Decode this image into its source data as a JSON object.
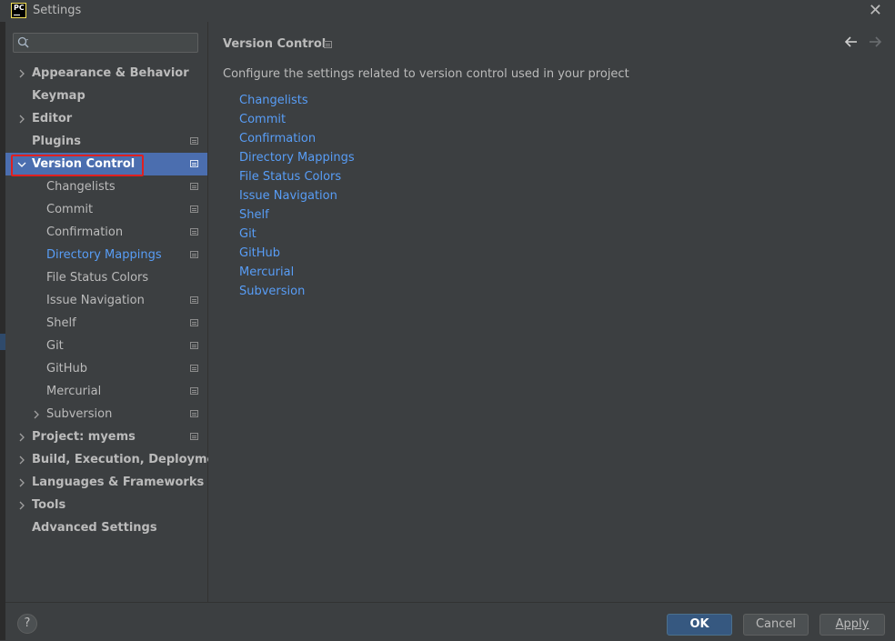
{
  "window": {
    "title": "Settings",
    "app_logo_text": "PC"
  },
  "sidebar": {
    "search": {
      "value": "",
      "placeholder": ""
    },
    "items": [
      {
        "label": "Appearance & Behavior",
        "level": 0,
        "expandable": true,
        "expanded": false,
        "project_icon": false
      },
      {
        "label": "Keymap",
        "level": 0,
        "expandable": false,
        "project_icon": false
      },
      {
        "label": "Editor",
        "level": 0,
        "expandable": true,
        "expanded": false,
        "project_icon": false
      },
      {
        "label": "Plugins",
        "level": 0,
        "expandable": false,
        "project_icon": true
      },
      {
        "label": "Version Control",
        "level": 0,
        "expandable": true,
        "expanded": true,
        "selected": true,
        "project_icon": true
      },
      {
        "label": "Changelists",
        "level": 1,
        "project_icon": true
      },
      {
        "label": "Commit",
        "level": 1,
        "project_icon": true
      },
      {
        "label": "Confirmation",
        "level": 1,
        "project_icon": true
      },
      {
        "label": "Directory Mappings",
        "level": 1,
        "project_icon": true,
        "link_style": true
      },
      {
        "label": "File Status Colors",
        "level": 1,
        "project_icon": false
      },
      {
        "label": "Issue Navigation",
        "level": 1,
        "project_icon": true
      },
      {
        "label": "Shelf",
        "level": 1,
        "project_icon": true
      },
      {
        "label": "Git",
        "level": 1,
        "project_icon": true
      },
      {
        "label": "GitHub",
        "level": 1,
        "project_icon": true
      },
      {
        "label": "Mercurial",
        "level": 1,
        "project_icon": true
      },
      {
        "label": "Subversion",
        "level": 1,
        "expandable": true,
        "expanded": false,
        "project_icon": true
      },
      {
        "label": "Project: myems",
        "level": 0,
        "expandable": true,
        "expanded": false,
        "project_icon": true
      },
      {
        "label": "Build, Execution, Deployment",
        "level": 0,
        "expandable": true,
        "expanded": false,
        "project_icon": false
      },
      {
        "label": "Languages & Frameworks",
        "level": 0,
        "expandable": true,
        "expanded": false,
        "project_icon": false
      },
      {
        "label": "Tools",
        "level": 0,
        "expandable": true,
        "expanded": false,
        "project_icon": false
      },
      {
        "label": "Advanced Settings",
        "level": 0,
        "expandable": false,
        "project_icon": false
      }
    ]
  },
  "main": {
    "title": "Version Control",
    "description": "Configure the settings related to version control used in your project",
    "links": [
      "Changelists",
      "Commit",
      "Confirmation",
      "Directory Mappings",
      "File Status Colors",
      "Issue Navigation",
      "Shelf",
      "Git",
      "GitHub",
      "Mercurial",
      "Subversion"
    ]
  },
  "footer": {
    "help_label": "?",
    "ok_label": "OK",
    "cancel_label": "Cancel",
    "apply_label": "Apply"
  },
  "colors": {
    "background": "#3c3f41",
    "selection": "#4b6eaf",
    "link": "#589df6",
    "highlight_box": "#e02020",
    "ok_button": "#365880"
  },
  "icons": {
    "close": "close-icon",
    "search": "search-icon",
    "project_scope": "project-scope-icon",
    "back": "arrow-left-icon",
    "forward": "arrow-right-icon",
    "help": "help-icon"
  }
}
